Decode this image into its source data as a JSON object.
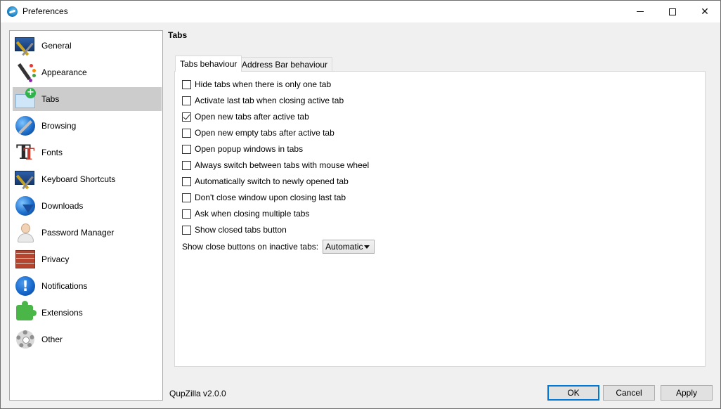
{
  "window": {
    "title": "Preferences",
    "controls": {
      "minimize": "minimize",
      "maximize": "maximize",
      "close": "✕"
    }
  },
  "sidebar": {
    "items": [
      {
        "label": "General",
        "icon": "general-icon",
        "active": false
      },
      {
        "label": "Appearance",
        "icon": "appearance-icon",
        "active": false
      },
      {
        "label": "Tabs",
        "icon": "tabs-icon",
        "active": true
      },
      {
        "label": "Browsing",
        "icon": "browsing-icon",
        "active": false
      },
      {
        "label": "Fonts",
        "icon": "fonts-icon",
        "active": false
      },
      {
        "label": "Keyboard Shortcuts",
        "icon": "keyboard-shortcuts-icon",
        "active": false
      },
      {
        "label": "Downloads",
        "icon": "downloads-icon",
        "active": false
      },
      {
        "label": "Password Manager",
        "icon": "password-manager-icon",
        "active": false
      },
      {
        "label": "Privacy",
        "icon": "privacy-icon",
        "active": false
      },
      {
        "label": "Notifications",
        "icon": "notifications-icon",
        "active": false
      },
      {
        "label": "Extensions",
        "icon": "extensions-icon",
        "active": false
      },
      {
        "label": "Other",
        "icon": "other-icon",
        "active": false
      }
    ]
  },
  "main": {
    "section_title": "Tabs",
    "tabs": [
      {
        "label": "Tabs behaviour",
        "active": true
      },
      {
        "label": "Address Bar behaviour",
        "active": false
      }
    ],
    "options": [
      {
        "label": "Hide tabs when there is only one tab",
        "checked": false
      },
      {
        "label": "Activate last tab when closing active tab",
        "checked": false
      },
      {
        "label": "Open new tabs after active tab",
        "checked": true
      },
      {
        "label": "Open new empty tabs after active tab",
        "checked": false
      },
      {
        "label": "Open popup windows in tabs",
        "checked": false
      },
      {
        "label": "Always switch between tabs with mouse wheel",
        "checked": false
      },
      {
        "label": "Automatically switch to newly opened tab",
        "checked": false
      },
      {
        "label": "Don't close window upon closing last tab",
        "checked": false
      },
      {
        "label": "Ask when closing multiple tabs",
        "checked": false
      },
      {
        "label": "Show closed tabs button",
        "checked": false
      }
    ],
    "close_buttons": {
      "label": "Show close buttons on inactive tabs:",
      "selected": "Automatic"
    }
  },
  "footer": {
    "version": "QupZilla v2.0.0",
    "ok_label": "OK",
    "cancel_label": "Cancel",
    "apply_label": "Apply"
  },
  "colors": {
    "accent": "#0078d7",
    "sidebar_active": "#cccccc",
    "window_bg": "#f0f0f0"
  }
}
